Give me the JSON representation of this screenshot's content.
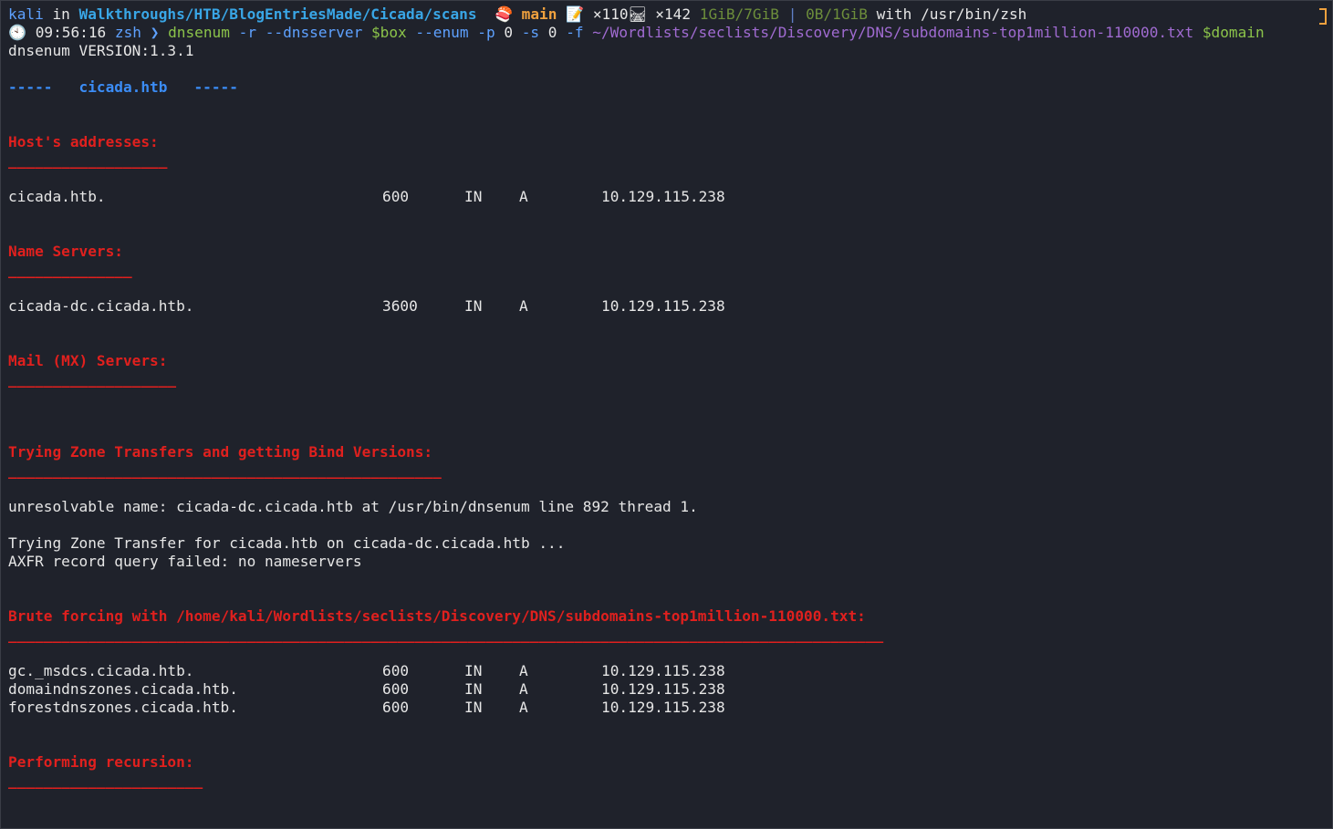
{
  "prompt": {
    "user": "kali",
    "in_text": " in ",
    "path": "Walkthroughs/HTB/BlogEntriesMade/Cicada/scans",
    "branch_icon": "🍣",
    "branch": "main",
    "memo_icon": "📝",
    "modified": "×110",
    "untracked_icon": "🛤",
    "untracked": "×142",
    "mem": "1GiB/7GiB",
    "sep": "|",
    "swap": "0B/1GiB",
    "with_text": " with ",
    "shell_path": "/usr/bin/zsh",
    "clock_icon": "🕙",
    "time": "09:56:16",
    "shell": "zsh",
    "arrow": "❯"
  },
  "command": {
    "cmd": "dnsenum",
    "args1": " -r --dnsserver ",
    "var_box": "$box",
    "args2": " --enum -p ",
    "p_val": "0",
    "args3": " -s ",
    "s_val": "0",
    "args4": " -f ",
    "wordlist": "~/Wordlists/seclists/Discovery/DNS/subdomains-top1million-110000.txt",
    "var_domain": "$domain"
  },
  "output": {
    "version": "dnsenum VERSION:1.3.1",
    "domain_banner": "-----   cicada.htb   -----",
    "host_heading": "Host's addresses:",
    "host_rule": "__________________",
    "host_records": [
      {
        "host": "cicada.htb.",
        "ttl": "600",
        "class": "IN",
        "type": "A",
        "ip": "10.129.115.238"
      }
    ],
    "ns_heading": "Name Servers:",
    "ns_rule": "______________",
    "ns_records": [
      {
        "host": "cicada-dc.cicada.htb.",
        "ttl": "3600",
        "class": "IN",
        "type": "A",
        "ip": "10.129.115.238"
      }
    ],
    "mx_heading": "Mail (MX) Servers:",
    "mx_rule": "___________________",
    "zt_heading": "Trying Zone Transfers and getting Bind Versions:",
    "zt_rule": "_________________________________________________",
    "unresolvable": "unresolvable name: cicada-dc.cicada.htb at /usr/bin/dnsenum line 892 thread 1.",
    "zt_trying": "Trying Zone Transfer for cicada.htb on cicada-dc.cicada.htb ...",
    "axfr_failed": "AXFR record query failed: no nameservers",
    "bf_heading": "Brute forcing with /home/kali/Wordlists/seclists/Discovery/DNS/subdomains-top1million-110000.txt:",
    "bf_rule": "___________________________________________________________________________________________________",
    "bf_records": [
      {
        "host": "gc._msdcs.cicada.htb.",
        "ttl": "600",
        "class": "IN",
        "type": "A",
        "ip": "10.129.115.238"
      },
      {
        "host": "domaindnszones.cicada.htb.",
        "ttl": "600",
        "class": "IN",
        "type": "A",
        "ip": "10.129.115.238"
      },
      {
        "host": "forestdnszones.cicada.htb.",
        "ttl": "600",
        "class": "IN",
        "type": "A",
        "ip": "10.129.115.238"
      }
    ],
    "rec_heading": "Performing recursion:",
    "rec_rule": "______________________"
  },
  "colors": {
    "background": "#1f222b",
    "heading_red": "#e0201e",
    "path_blue": "#39a6e6",
    "branch_orange": "#f0a13e",
    "wordlist_purple": "#a06bd1",
    "command_green": "#8bc34a"
  }
}
